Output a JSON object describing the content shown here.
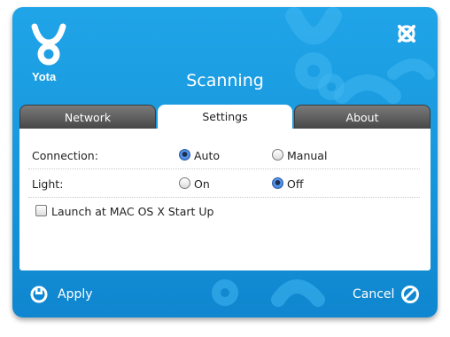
{
  "app": {
    "brand": "Yota",
    "title": "Scanning"
  },
  "tabs": [
    {
      "label": "Network",
      "active": false
    },
    {
      "label": "Settings",
      "active": true
    },
    {
      "label": "About",
      "active": false
    }
  ],
  "settings": {
    "connection": {
      "label": "Connection:",
      "options": [
        {
          "label": "Auto",
          "selected": true
        },
        {
          "label": "Manual",
          "selected": false
        }
      ]
    },
    "light": {
      "label": "Light:",
      "options": [
        {
          "label": "On",
          "selected": false
        },
        {
          "label": "Off",
          "selected": true
        }
      ]
    },
    "launch_at_startup": {
      "label": "Launch at MAC OS X Start Up",
      "checked": false
    }
  },
  "footer": {
    "apply_label": "Apply",
    "cancel_label": "Cancel"
  },
  "icons": {
    "logo": "yota-logo-icon",
    "close": "close-icon",
    "apply": "apply-icon",
    "cancel": "cancel-icon"
  },
  "colors": {
    "window_bg": "#1796dc",
    "tab_inactive": "#5e5e5e",
    "radio_selected": "#2a6bd0"
  }
}
